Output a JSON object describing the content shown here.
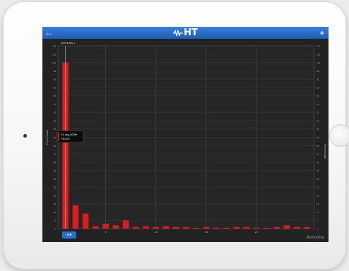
{
  "device": {
    "camera": "camera-dot",
    "home_button": "home-button"
  },
  "topbar": {
    "back_icon": "←",
    "logo_text": "HT",
    "add_icon": "+",
    "accent": "#2a6ed0"
  },
  "chart_panel": {
    "series_label": "Armonica 1",
    "nav_button_label": "◂ ▸"
  },
  "chart_data": {
    "type": "bar",
    "categories": [
      1,
      2,
      3,
      4,
      5,
      6,
      7,
      8,
      9,
      10,
      11,
      12,
      13,
      14,
      15,
      16,
      17,
      18,
      19,
      20,
      21,
      22,
      23,
      24,
      25
    ],
    "values": [
      100,
      14,
      9,
      1.5,
      3,
      2,
      5,
      1,
      1.5,
      1,
      1.5,
      1,
      1,
      0.5,
      1,
      0.5,
      0.5,
      1,
      1,
      0.5,
      0.5,
      1,
      2,
      1,
      1
    ],
    "bar_color": "#d91e1e",
    "ylim": [
      0,
      110
    ],
    "y_ticks": [
      0,
      5,
      10,
      15,
      20,
      25,
      30,
      35,
      40,
      45,
      50,
      55,
      60,
      65,
      70,
      75,
      80,
      85,
      90,
      95,
      100,
      105,
      110
    ],
    "x_ticks": [
      5,
      10,
      15,
      20
    ],
    "xlabel": "Armonica",
    "ylabel": "Percentuale",
    "ylabel_right": "Percentuale",
    "tooltip": {
      "line1": "V1 arg.100%",
      "line2": "+40.2V"
    },
    "grid": true
  }
}
